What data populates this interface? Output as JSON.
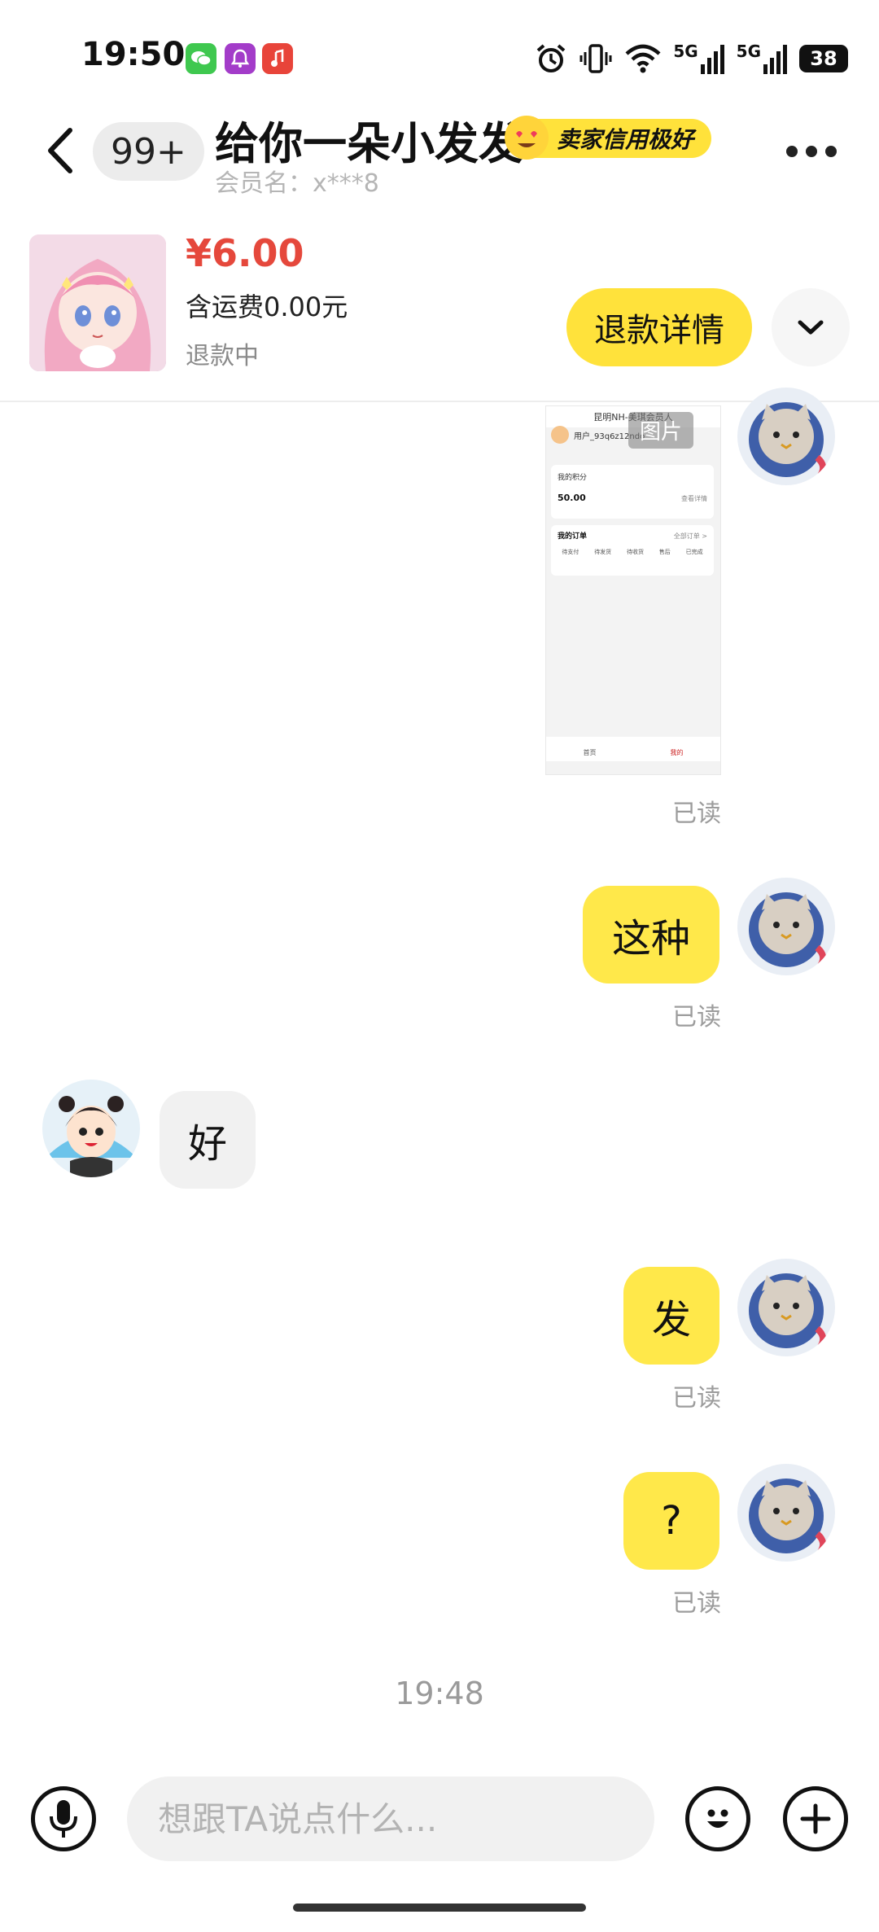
{
  "status_bar": {
    "time": "19:50",
    "network_1": "5G",
    "network_2": "5G",
    "battery": "38",
    "icons": [
      "wechat-icon",
      "notification-app-icon",
      "music-app-icon",
      "alarm-icon",
      "vibrate-icon",
      "wifi-icon",
      "signal-icon",
      "battery-icon"
    ]
  },
  "header": {
    "unread_count": "99+",
    "title": "给你一朵小发发",
    "credit_badge": "卖家信用极好",
    "member_label": "会员名：x***8"
  },
  "product": {
    "price": "¥6.00",
    "shipping": "含运费0.00元",
    "status": "退款中",
    "refund_button": "退款详情"
  },
  "screenshot_preview": {
    "badge": "图片",
    "app_title": "昆明NH-美琪会员人",
    "user": "用户_93q6z12ndo",
    "points_label": "我的积分",
    "points_value": "50.00",
    "points_link": "查看详情",
    "orders_label": "我的订单",
    "orders_link": "全部订单 >",
    "order_tabs": [
      "待支付",
      "待发货",
      "待收货",
      "售后",
      "已完成"
    ],
    "nav": [
      "首页",
      "我的"
    ]
  },
  "messages": [
    {
      "from": "me",
      "text": "这种",
      "status": "已读"
    },
    {
      "from": "them",
      "text": "好"
    },
    {
      "from": "me",
      "text": "发",
      "status": "已读"
    },
    {
      "from": "me",
      "text": "?",
      "status": "已读"
    }
  ],
  "image_message_status": "已读",
  "time_divider": "19:48",
  "input": {
    "placeholder": "想跟TA说点什么..."
  },
  "colors": {
    "accent_yellow": "#ffe23b",
    "price_red": "#e5483c",
    "bubble_me": "#ffe84a",
    "bubble_them": "#f1f1f1"
  }
}
